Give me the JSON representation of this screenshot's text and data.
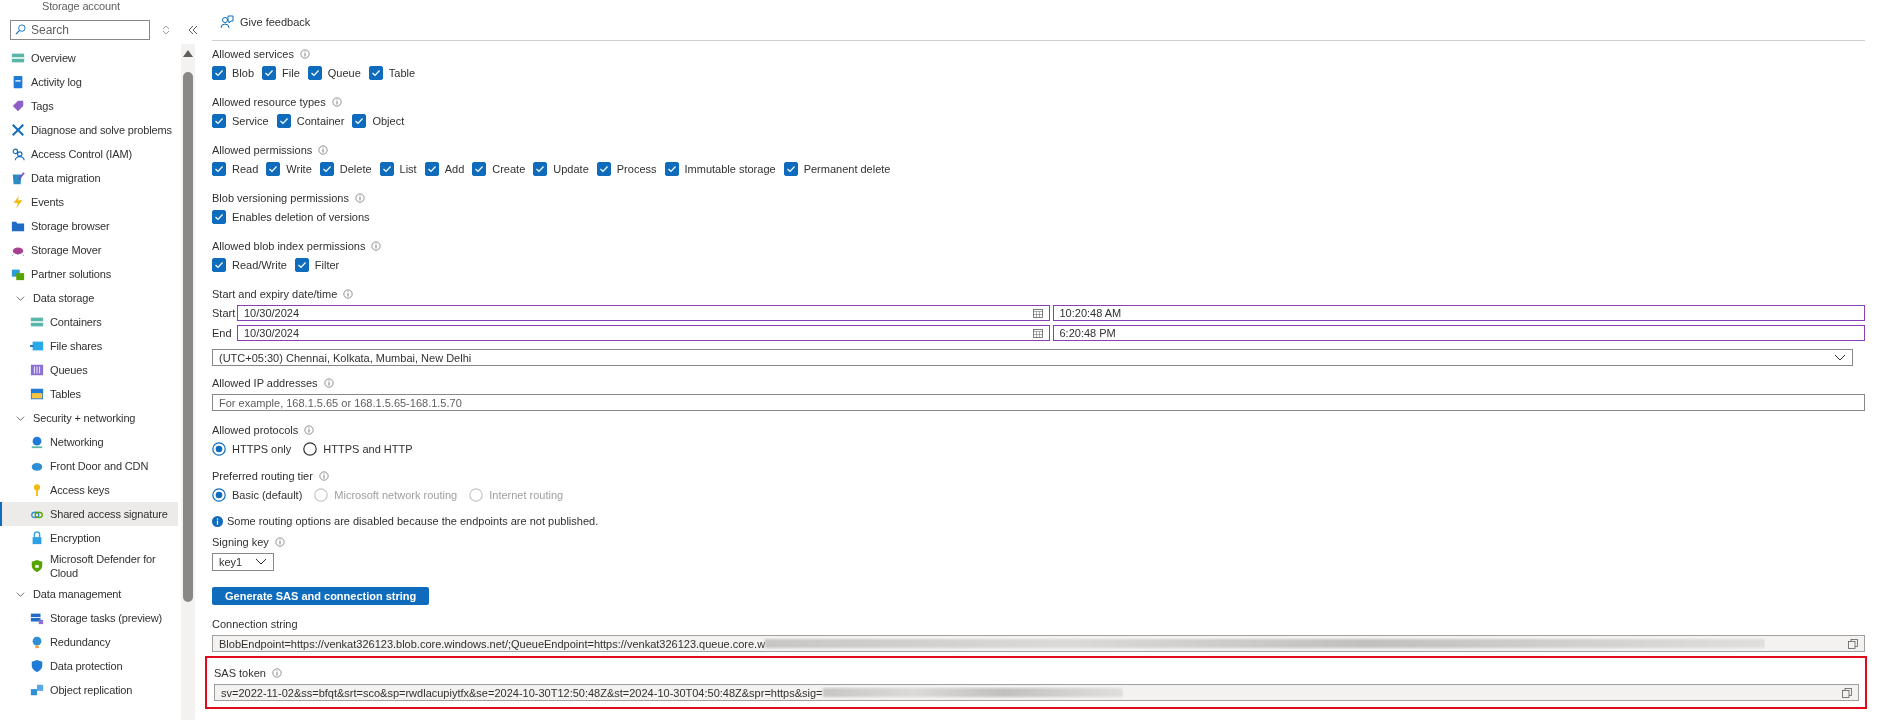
{
  "sidebar": {
    "resource_type": "Storage account",
    "search": {
      "placeholder": "Search"
    },
    "items": [
      {
        "label": "Overview",
        "selected": false
      },
      {
        "label": "Activity log",
        "selected": false
      },
      {
        "label": "Tags",
        "selected": false
      },
      {
        "label": "Diagnose and solve problems",
        "selected": false
      },
      {
        "label": "Access Control (IAM)",
        "selected": false
      },
      {
        "label": "Data migration",
        "selected": false
      },
      {
        "label": "Events",
        "selected": false
      },
      {
        "label": "Storage browser",
        "selected": false
      },
      {
        "label": "Storage Mover",
        "selected": false
      },
      {
        "label": "Partner solutions",
        "selected": false
      },
      {
        "label": "Data storage",
        "expanded": true,
        "children": [
          {
            "label": "Containers",
            "selected": false
          },
          {
            "label": "File shares",
            "selected": false
          },
          {
            "label": "Queues",
            "selected": false
          },
          {
            "label": "Tables",
            "selected": false
          }
        ]
      },
      {
        "label": "Security + networking",
        "expanded": true,
        "children": [
          {
            "label": "Networking",
            "selected": false
          },
          {
            "label": "Front Door and CDN",
            "selected": false
          },
          {
            "label": "Access keys",
            "selected": false
          },
          {
            "label": "Shared access signature",
            "selected": true
          },
          {
            "label": "Encryption",
            "selected": false
          },
          {
            "label": "Microsoft Defender for Cloud",
            "selected": false
          }
        ]
      },
      {
        "label": "Data management",
        "expanded": true,
        "children": [
          {
            "label": "Storage tasks (preview)",
            "selected": false
          },
          {
            "label": "Redundancy",
            "selected": false
          },
          {
            "label": "Data protection",
            "selected": false
          },
          {
            "label": "Object replication",
            "selected": false
          }
        ]
      }
    ]
  },
  "toolbar": {
    "feedback": "Give feedback"
  },
  "form": [
    {
      "kind": "checkboxes",
      "label": "Allowed services",
      "options": [
        {
          "label": "Blob",
          "checked": true
        },
        {
          "label": "File",
          "checked": true
        },
        {
          "label": "Queue",
          "checked": true
        },
        {
          "label": "Table",
          "checked": true
        }
      ]
    },
    {
      "kind": "checkboxes",
      "label": "Allowed resource types",
      "options": [
        {
          "label": "Service",
          "checked": true
        },
        {
          "label": "Container",
          "checked": true
        },
        {
          "label": "Object",
          "checked": true
        }
      ]
    },
    {
      "kind": "checkboxes",
      "label": "Allowed permissions",
      "options": [
        {
          "label": "Read",
          "checked": true
        },
        {
          "label": "Write",
          "checked": true
        },
        {
          "label": "Delete",
          "checked": true
        },
        {
          "label": "List",
          "checked": true
        },
        {
          "label": "Add",
          "checked": true
        },
        {
          "label": "Create",
          "checked": true
        },
        {
          "label": "Update",
          "checked": true
        },
        {
          "label": "Process",
          "checked": true
        },
        {
          "label": "Immutable storage",
          "checked": true
        },
        {
          "label": "Permanent delete",
          "checked": true
        }
      ]
    },
    {
      "kind": "checkboxes",
      "label": "Blob versioning permissions",
      "options": [
        {
          "label": "Enables deletion of versions",
          "checked": true
        }
      ]
    },
    {
      "kind": "checkboxes",
      "label": "Allowed blob index permissions",
      "options": [
        {
          "label": "Read/Write",
          "checked": true
        },
        {
          "label": "Filter",
          "checked": true
        }
      ]
    },
    {
      "kind": "datetime",
      "label": "Start and expiry date/time",
      "rows": [
        {
          "label": "Start",
          "date": "10/30/2024",
          "time": "10:20:48 AM"
        },
        {
          "label": "End",
          "date": "10/30/2024",
          "time": "6:20:48 PM"
        }
      ],
      "timezone": "(UTC+05:30) Chennai, Kolkata, Mumbai, New Delhi"
    },
    {
      "kind": "text",
      "label": "Allowed IP addresses",
      "placeholder": "For example, 168.1.5.65 or 168.1.5.65-168.1.5.70"
    },
    {
      "kind": "radios",
      "label": "Allowed protocols",
      "options": [
        {
          "label": "HTTPS only",
          "selected": true,
          "disabled": false
        },
        {
          "label": "HTTPS and HTTP",
          "selected": false,
          "disabled": false
        }
      ]
    },
    {
      "kind": "radios",
      "label": "Preferred routing tier",
      "options": [
        {
          "label": "Basic (default)",
          "selected": true,
          "disabled": false
        },
        {
          "label": "Microsoft network routing",
          "selected": false,
          "disabled": true
        },
        {
          "label": "Internet routing",
          "selected": false,
          "disabled": true
        }
      ]
    },
    {
      "kind": "info",
      "text": "Some routing options are disabled because the endpoints are not published."
    },
    {
      "kind": "dropdown",
      "label": "Signing key",
      "value": "key1"
    },
    {
      "kind": "button",
      "text": "Generate SAS and connection string"
    },
    {
      "kind": "output",
      "label": "Connection string",
      "value": "BlobEndpoint=https://venkat326123.blob.core.windows.net/;QueueEndpoint=https://venkat326123.queue.core.w",
      "info": false,
      "highlighted": false
    },
    {
      "kind": "output",
      "label": "SAS token",
      "value": "sv=2022-11-02&ss=bfqt&srt=sco&sp=rwdlacupiytfx&se=2024-10-30T12:50:48Z&st=2024-10-30T04:50:48Z&spr=https&sig=",
      "info": true,
      "highlighted": true
    }
  ]
}
